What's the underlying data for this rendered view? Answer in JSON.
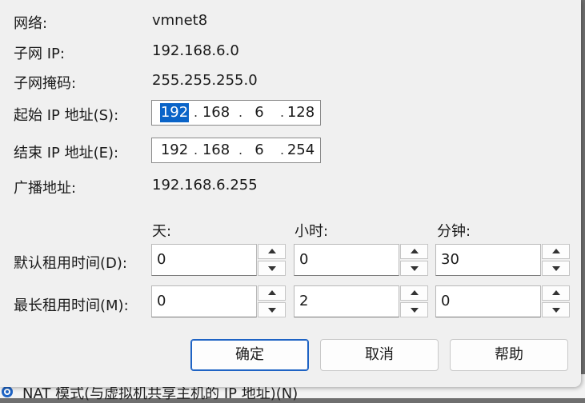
{
  "background": {
    "radio_label": "NAT 模式(与虚拟机共享主机的 IP 地址)(N)"
  },
  "info": {
    "network_label": "网络:",
    "network_value": "vmnet8",
    "subnet_ip_label": "子网 IP:",
    "subnet_ip_value": "192.168.6.0",
    "subnet_mask_label": "子网掩码:",
    "subnet_mask_value": "255.255.255.0",
    "broadcast_label": "广播地址:",
    "broadcast_value": "192.168.6.255"
  },
  "start_ip": {
    "label": "起始 IP 地址(S):",
    "octets": [
      "192",
      "168",
      "6",
      "128"
    ],
    "dots": [
      ".",
      ".",
      "."
    ]
  },
  "end_ip": {
    "label": "结束 IP 地址(E):",
    "octets": [
      "192",
      "168",
      "6",
      "254"
    ],
    "dots": [
      ".",
      ".",
      "."
    ]
  },
  "lease": {
    "col_days": "天:",
    "col_hours": "小时:",
    "col_minutes": "分钟:",
    "default_label": "默认租用时间(D):",
    "default_days": "0",
    "default_hours": "0",
    "default_minutes": "30",
    "max_label": "最长租用时间(M):",
    "max_days": "0",
    "max_hours": "2",
    "max_minutes": "0"
  },
  "buttons": {
    "ok": "确定",
    "cancel": "取消",
    "help": "帮助"
  },
  "colors": {
    "selection": "#0a64c8",
    "default_button_border": "#1e63c4",
    "dialog_bg": "#f0f0f0"
  }
}
